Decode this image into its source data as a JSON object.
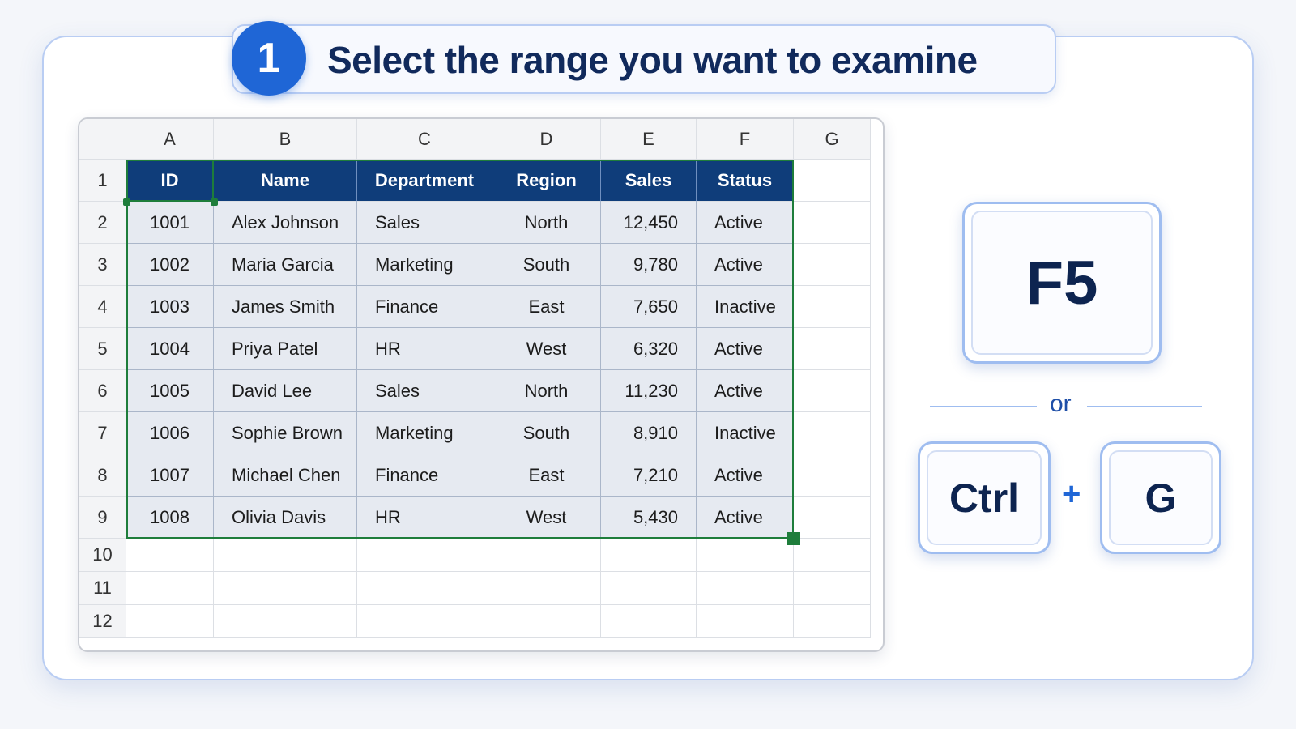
{
  "step": {
    "number": "1",
    "title": "Select the range you want to examine"
  },
  "sheet": {
    "columns": [
      "A",
      "B",
      "C",
      "D",
      "E",
      "F",
      "G"
    ],
    "rows": [
      "1",
      "2",
      "3",
      "4",
      "5",
      "6",
      "7",
      "8",
      "9",
      "10",
      "11",
      "12"
    ],
    "headers": [
      "ID",
      "Name",
      "Department",
      "Region",
      "Sales",
      "Status"
    ],
    "data": [
      [
        "1001",
        "Alex Johnson",
        "Sales",
        "North",
        "12,450",
        "Active"
      ],
      [
        "1002",
        "Maria Garcia",
        "Marketing",
        "South",
        "9,780",
        "Active"
      ],
      [
        "1003",
        "James Smith",
        "Finance",
        "East",
        "7,650",
        "Inactive"
      ],
      [
        "1004",
        "Priya Patel",
        "HR",
        "West",
        "6,320",
        "Active"
      ],
      [
        "1005",
        "David Lee",
        "Sales",
        "North",
        "11,230",
        "Active"
      ],
      [
        "1006",
        "Sophie Brown",
        "Marketing",
        "South",
        "8,910",
        "Inactive"
      ],
      [
        "1007",
        "Michael Chen",
        "Finance",
        "East",
        "7,210",
        "Active"
      ],
      [
        "1008",
        "Olivia Davis",
        "HR",
        "West",
        "5,430",
        "Active"
      ]
    ]
  },
  "shortcuts": {
    "primary_key": "F5",
    "separator": "or",
    "combo_key_1": "Ctrl",
    "combo_plus": "+",
    "combo_key_2": "G"
  },
  "colors": {
    "accent": "#1f66d6",
    "header_fill": "#0f3d7a",
    "selection_border": "#1e7d3b",
    "selected_fill": "#e6eaf1"
  }
}
